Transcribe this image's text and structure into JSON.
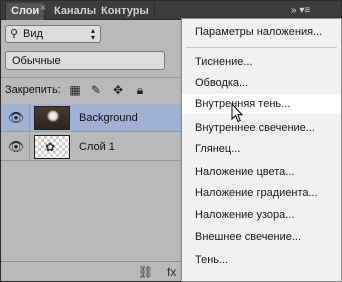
{
  "tabs": [
    "Слои",
    "Каналы",
    "Контуры"
  ],
  "tab_close_glyph": "×",
  "panel_menu_glyph": "»  ▾≡",
  "filter": {
    "icon": "search-icon",
    "label": "Вид",
    "arrow": "▴▾"
  },
  "blend_mode": "Обычные",
  "lock": {
    "label": "Закрепить:",
    "icons": [
      "lock-transparent-icon",
      "lock-brush-icon",
      "lock-move-icon",
      "lock-all-icon"
    ]
  },
  "layers": [
    {
      "name": "Background",
      "selected": true,
      "visible": true
    },
    {
      "name": "Слой 1",
      "selected": false,
      "visible": true
    }
  ],
  "context_menu": {
    "items": [
      "Параметры наложения...",
      "Тиснение...",
      "Обводка...",
      "Внутренняя тень...",
      "Внутреннее свечение...",
      "Глянец...",
      "Наложение цвета...",
      "Наложение градиента...",
      "Наложение узора...",
      "Внешнее свечение...",
      "Тень..."
    ],
    "hovered_index": 3
  }
}
